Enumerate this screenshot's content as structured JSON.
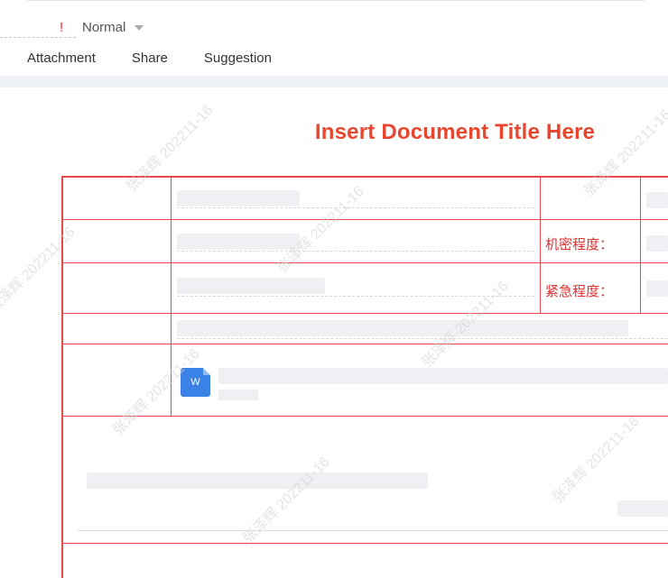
{
  "header": {
    "priority_mark": "!",
    "priority_value": "Normal"
  },
  "tabs": [
    {
      "label": "Attachment"
    },
    {
      "label": "Share"
    },
    {
      "label": "Suggestion"
    }
  ],
  "document": {
    "title": "Insert Document Title Here",
    "confidentiality_label": "机密程度：",
    "urgency_label": "紧急程度："
  },
  "watermark": {
    "text": "张泽辉 202211-16"
  },
  "attachment": {
    "icon_letter": "W"
  },
  "colors": {
    "accent_red": "#e74848",
    "title_red": "#e8462e",
    "word_blue": "#3b82e6"
  }
}
